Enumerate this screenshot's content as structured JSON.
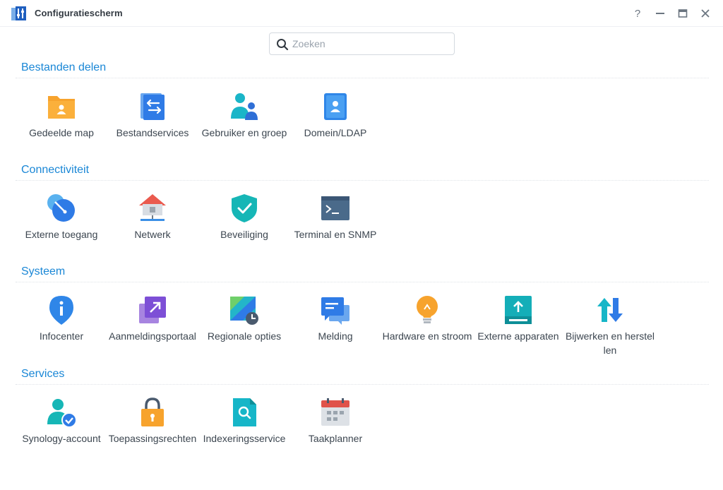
{
  "window": {
    "title": "Configuratiescherm",
    "controls": {
      "help": "?"
    }
  },
  "search": {
    "placeholder": "Zoeken",
    "value": ""
  },
  "sections": [
    {
      "title": "Bestanden delen",
      "items": [
        {
          "label": "Gedeelde map",
          "icon": "shared-folder-icon"
        },
        {
          "label": "Bestandservices",
          "icon": "file-services-icon"
        },
        {
          "label": "Gebruiker en groep",
          "icon": "user-group-icon"
        },
        {
          "label": "Domein/LDAP",
          "icon": "domain-ldap-icon"
        }
      ]
    },
    {
      "title": "Connectiviteit",
      "items": [
        {
          "label": "Externe toegang",
          "icon": "external-access-icon"
        },
        {
          "label": "Netwerk",
          "icon": "network-icon"
        },
        {
          "label": "Beveiliging",
          "icon": "security-shield-icon"
        },
        {
          "label": "Terminal en SNMP",
          "icon": "terminal-icon"
        }
      ]
    },
    {
      "title": "Systeem",
      "items": [
        {
          "label": "Infocenter",
          "icon": "info-center-icon"
        },
        {
          "label": "Aanmeldingsportaal",
          "icon": "login-portal-icon"
        },
        {
          "label": "Regionale opties",
          "icon": "regional-options-icon"
        },
        {
          "label": "Melding",
          "icon": "notification-icon"
        },
        {
          "label": "Hardware en stroom",
          "icon": "hardware-power-icon"
        },
        {
          "label": "Externe apparaten",
          "icon": "external-devices-icon"
        },
        {
          "label": "Bijwerken en herstellen",
          "icon": "update-restore-icon"
        }
      ]
    },
    {
      "title": "Services",
      "items": [
        {
          "label": "Synology-account",
          "icon": "synology-account-icon"
        },
        {
          "label": "Toepassingsrechten",
          "icon": "application-privileges-icon"
        },
        {
          "label": "Indexeringsservice",
          "icon": "indexing-service-icon"
        },
        {
          "label": "Taakplanner",
          "icon": "task-scheduler-icon"
        }
      ]
    }
  ],
  "colors": {
    "accent": "#1a87d6",
    "title_text": "#333a42",
    "label_text": "#3c4650"
  }
}
